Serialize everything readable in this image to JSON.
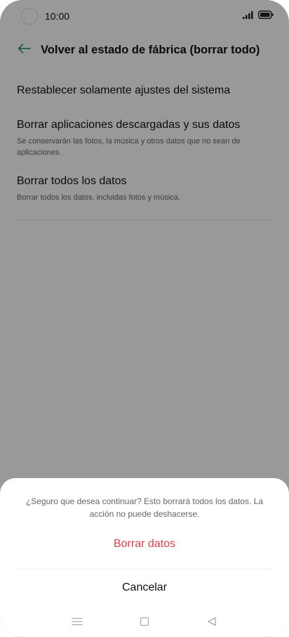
{
  "status_bar": {
    "time": "10:00",
    "icons": [
      "camera-cutout",
      "signal-icon",
      "battery-icon"
    ]
  },
  "header": {
    "back_icon": "arrow-left-icon",
    "title": "Volver al estado de fábrica (borrar todo)"
  },
  "options": [
    {
      "title": "Restablecer solamente ajustes del sistema"
    },
    {
      "title": "Borrar aplicaciones descargadas y sus datos",
      "description": "Se conservarán las fotos, la música y otros datos que no sean de aplicaciones."
    },
    {
      "title": "Borrar todos los datos",
      "description": "Borrar todos los datos, incluidas fotos y música."
    }
  ],
  "dialog": {
    "message": "¿Seguro que desea continuar? Esto borrará todos los datos. La acción no puede deshacerse.",
    "confirm_label": "Borrar datos",
    "cancel_label": "Cancelar"
  },
  "nav_bar": {
    "icons": [
      "menu-icon",
      "home-icon",
      "back-icon"
    ]
  },
  "colors": {
    "accent": "#2e9e6b",
    "destructive": "#e03e4f"
  }
}
